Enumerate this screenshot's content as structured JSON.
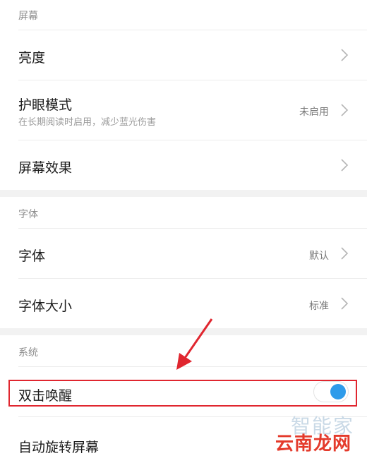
{
  "sections": {
    "screen": "屏幕",
    "font": "字体",
    "system": "系统"
  },
  "rows": {
    "brightness": {
      "title": "亮度"
    },
    "eye_care": {
      "title": "护眼模式",
      "subtitle": "在长期阅读时启用，减少蓝光伤害",
      "value": "未启用"
    },
    "screen_effect": {
      "title": "屏幕效果"
    },
    "font": {
      "title": "字体",
      "value": "默认"
    },
    "font_size": {
      "title": "字体大小",
      "value": "标准"
    },
    "double_tap_wake": {
      "title": "双击唤醒",
      "toggle_on": true
    },
    "auto_rotate": {
      "title": "自动旋转屏幕"
    }
  },
  "icons": {
    "chevron": "chevron-right-icon",
    "annotation": "red-arrow-pointer"
  },
  "colors": {
    "toggle_on": "#2e9bea",
    "highlight": "#e0262f",
    "section_bg": "#f2f2f2"
  },
  "watermark": {
    "top": "智能家",
    "bottom": "云南龙网"
  }
}
